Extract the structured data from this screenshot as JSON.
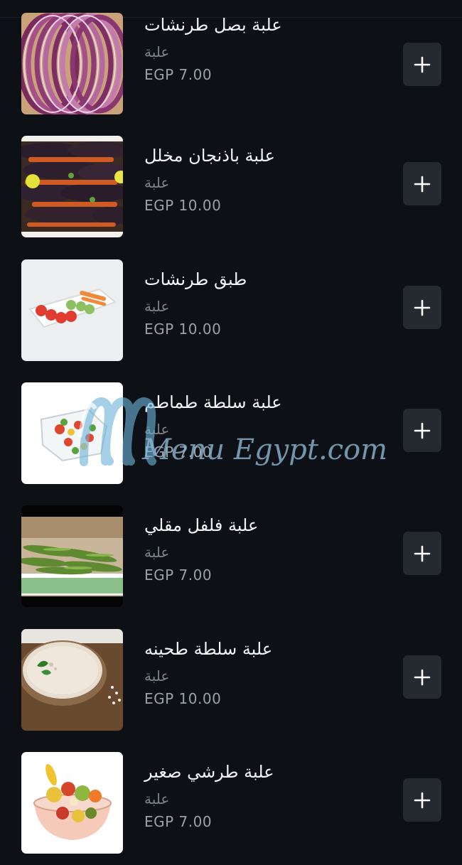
{
  "menu": {
    "items": [
      {
        "title": "علبة بصل طرنشات",
        "unit": "علبة",
        "price": "EGP 7.00",
        "image": "red-onion-slices"
      },
      {
        "title": "علبة باذنجان مخلل",
        "unit": "علبة",
        "price": "EGP 10.00",
        "image": "pickled-eggplant"
      },
      {
        "title": "طبق طرنشات",
        "unit": "علبة",
        "price": "EGP 10.00",
        "image": "salad-plate"
      },
      {
        "title": "علبة سلطة طماطم",
        "unit": "علبة",
        "price": "EGP 7.00",
        "image": "tomato-salad-box"
      },
      {
        "title": "علبة فلفل مقلي",
        "unit": "علبة",
        "price": "EGP 7.00",
        "image": "fried-green-peppers"
      },
      {
        "title": "علبة سلطة طحينه",
        "unit": "علبة",
        "price": "EGP 10.00",
        "image": "tahini-bowl"
      },
      {
        "title": "علبة طرشي صغير",
        "unit": "علبة",
        "price": "EGP 7.00",
        "image": "pickles-bowl"
      }
    ],
    "add_icon": "plus-icon"
  },
  "watermark": {
    "text": "Menu Egypt.com",
    "color": "#6fb3d9"
  },
  "colors": {
    "background": "#0d1116",
    "button": "#252a30",
    "title": "#f2f4f6",
    "muted": "#7c8389"
  }
}
